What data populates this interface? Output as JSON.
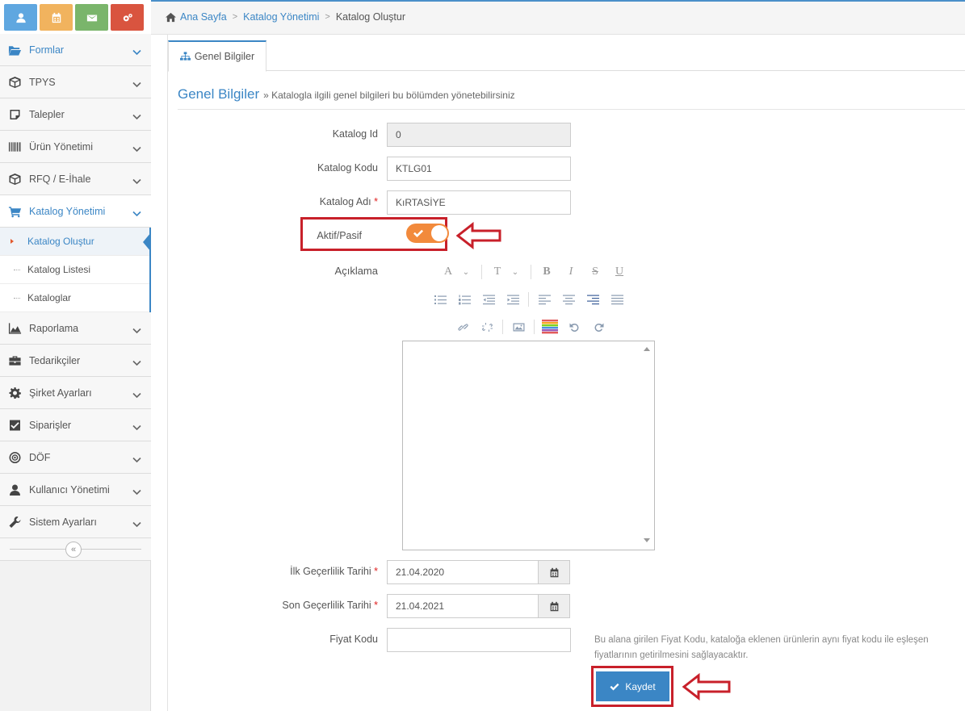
{
  "breadcrumb": {
    "home": "Ana Sayfa",
    "section": "Katalog Yönetimi",
    "current": "Katalog Oluştur"
  },
  "shortcuts": [
    {
      "icon": "user-icon",
      "color": "#5fa7e0"
    },
    {
      "icon": "calendar-icon",
      "color": "#f1b35e"
    },
    {
      "icon": "envelope-icon",
      "color": "#7ab56b"
    },
    {
      "icon": "cogs-icon",
      "color": "#d9543f"
    }
  ],
  "sidebar": {
    "items": [
      {
        "label": "Formlar",
        "icon": "folder-open-icon"
      },
      {
        "label": "TPYS",
        "icon": "cube-icon"
      },
      {
        "label": "Talepler",
        "icon": "sticky-note-icon"
      },
      {
        "label": "Ürün Yönetimi",
        "icon": "barcode-icon"
      },
      {
        "label": "RFQ / E-İhale",
        "icon": "cube-icon"
      },
      {
        "label": "Katalog Yönetimi",
        "icon": "cart-icon"
      },
      {
        "label": "Raporlama",
        "icon": "area-chart-icon"
      },
      {
        "label": "Tedarikçiler",
        "icon": "briefcase-icon"
      },
      {
        "label": "Şirket Ayarları",
        "icon": "gear-icon"
      },
      {
        "label": "Siparişler",
        "icon": "check-square-icon"
      },
      {
        "label": "DÖF",
        "icon": "bullseye-icon"
      },
      {
        "label": "Kullanıcı Yönetimi",
        "icon": "user-icon"
      },
      {
        "label": "Sistem Ayarları",
        "icon": "wrench-icon"
      }
    ],
    "sub_items": [
      {
        "label": "Katalog Oluştur"
      },
      {
        "label": "Katalog Listesi"
      },
      {
        "label": "Kataloglar"
      }
    ],
    "collapse_glyph": "«"
  },
  "tab": {
    "label": "Genel Bilgiler",
    "icon": "sitemap-icon"
  },
  "section": {
    "title": "Genel Bilgiler",
    "subtitle": "» Katalogla ilgili genel bilgileri bu bölümden yönetebilirsiniz"
  },
  "form": {
    "catalog_id": {
      "label": "Katalog Id",
      "value": "0"
    },
    "catalog_code": {
      "label": "Katalog Kodu",
      "value": "KTLG01"
    },
    "catalog_name": {
      "label": "Katalog Adı",
      "value": "KıRTASİYE",
      "required": "*"
    },
    "active": {
      "label": "Aktif/Pasif",
      "on": true
    },
    "description": {
      "label": "Açıklama"
    },
    "start_date": {
      "label": "İlk Geçerlilik Tarihi",
      "value": "21.04.2020",
      "required": "*"
    },
    "end_date": {
      "label": "Son Geçerlilik Tarihi",
      "value": "21.04.2021",
      "required": "*"
    },
    "price_code": {
      "label": "Fiyat Kodu",
      "value": ""
    },
    "price_code_help": "Bu alana girilen Fiyat Kodu, kataloğa eklenen ürünlerin aynı fiyat kodu ile eşleşen fiyatlarının getirilmesini sağlayacaktır."
  },
  "editor_toolbar": {
    "row1": [
      "A",
      "T"
    ],
    "row1_fmt": [
      "B",
      "I",
      "S",
      "U"
    ]
  },
  "save_label": "Kaydet",
  "colors": {
    "accent": "#3b86c5",
    "toggle": "#f28a3c",
    "highlight": "#c8202a"
  }
}
